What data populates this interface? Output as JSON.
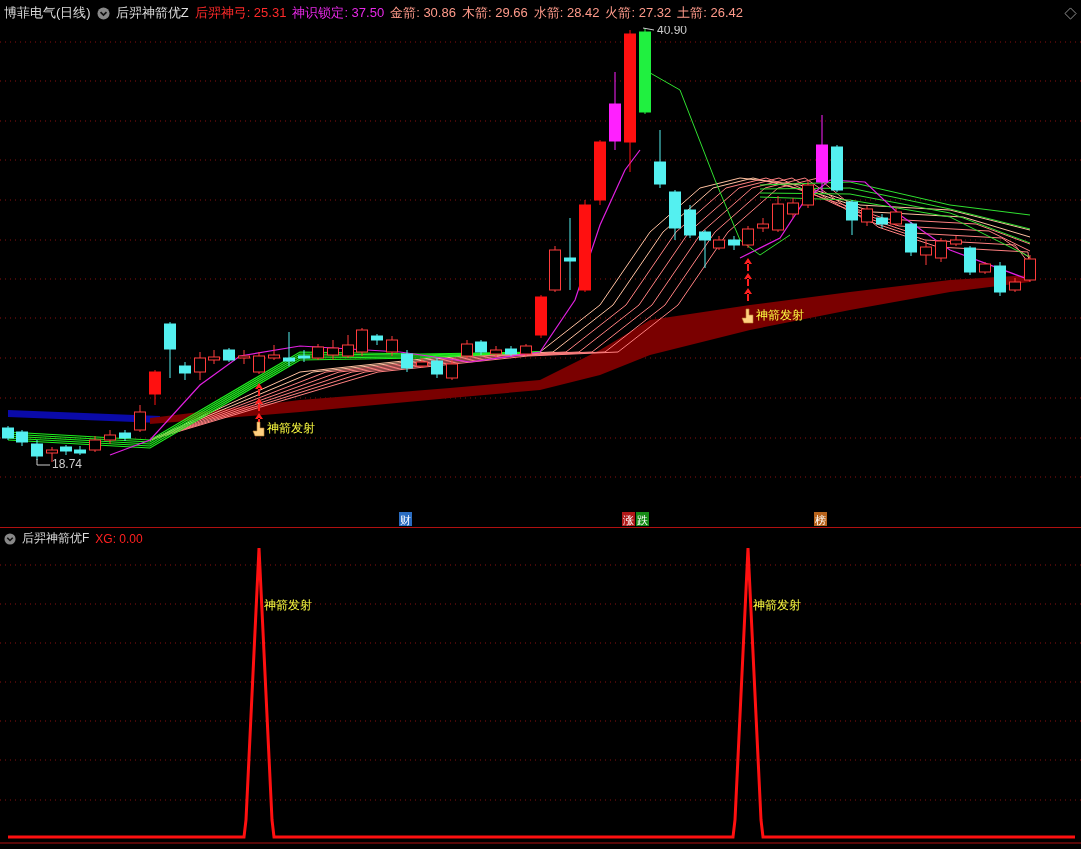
{
  "header": {
    "symbol": "博菲电气(日线)",
    "indicator": "后羿神箭优Z",
    "readouts": [
      {
        "text": "后羿神弓: 25.31",
        "color": "#ff2a2a"
      },
      {
        "text": "神识锁定: 37.50",
        "color": "#e628e6"
      },
      {
        "text": "金箭: 30.86",
        "color": "#ff9a8a"
      },
      {
        "text": "木箭: 29.66",
        "color": "#ff9a8a"
      },
      {
        "text": "水箭: 28.42",
        "color": "#ff9a8a"
      },
      {
        "text": "火箭: 27.32",
        "color": "#ff9a8a"
      },
      {
        "text": "土箭: 26.42",
        "color": "#ff9a8a"
      }
    ]
  },
  "main_chart": {
    "high_label": "40.90",
    "low_label": "18.74",
    "signals": [
      {
        "text": "神箭发射"
      },
      {
        "text": "神箭发射"
      }
    ],
    "event_markers": [
      {
        "text": "财",
        "color": "#2a6cc0"
      },
      {
        "text": "涨",
        "color": "#b01818"
      },
      {
        "text": "跌",
        "color": "#168a16"
      },
      {
        "text": "榜",
        "color": "#b8641c"
      }
    ]
  },
  "sub_panel": {
    "indicator": "后羿神箭优F",
    "readout": "XG: 0.00",
    "signals": [
      {
        "text": "神箭发射"
      },
      {
        "text": "神箭发射"
      }
    ]
  }
}
